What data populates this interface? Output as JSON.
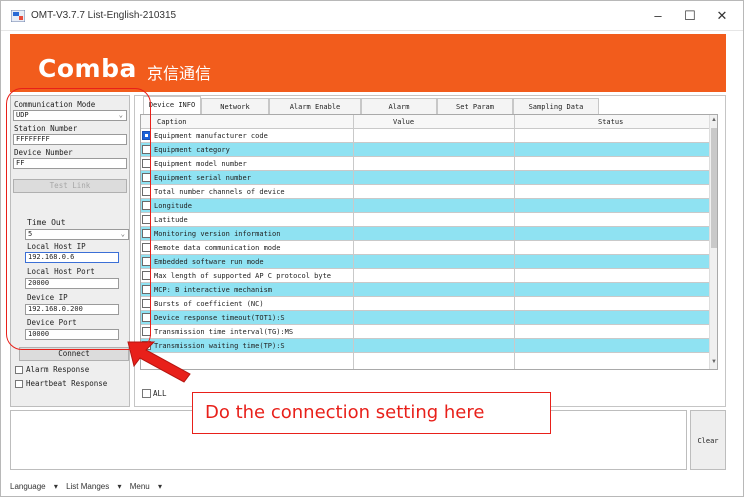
{
  "window": {
    "title": "OMT-V3.7.7  List-English-210315",
    "controls": [
      "–",
      "☐",
      "✕"
    ]
  },
  "banner": {
    "logo_en": "Comba",
    "logo_cn": "京信通信",
    "color": "#f25c1c"
  },
  "left": {
    "comm_mode_label": "Communication Mode",
    "comm_mode_value": "UDP",
    "station_number_label": "Station Number",
    "station_number_value": "FFFFFFFF",
    "device_number_label": "Device Number",
    "device_number_value": "FF",
    "test_link_label": "Test Link",
    "time_out_label": "Time Out",
    "time_out_value": "5",
    "local_host_ip_label": "Local Host IP",
    "local_host_ip_value": "192.168.0.6",
    "local_host_port_label": "Local Host Port",
    "local_host_port_value": "20000",
    "device_ip_label": "Device IP",
    "device_ip_value": "192.168.0.200",
    "device_port_label": "Device Port",
    "device_port_value": "10000",
    "connect_label": "Connect",
    "alarm_response_label": "Alarm Response",
    "heartbeat_response_label": "Heartbeat Response"
  },
  "tabs": [
    "Device INFO",
    "Network",
    "Alarm Enable",
    "Alarm",
    "Set Param",
    "Sampling Data"
  ],
  "grid": {
    "headers": {
      "caption": "Caption",
      "value": "Value",
      "status": "Status"
    },
    "rows": [
      "Equipment manufacturer code",
      "Equipment category",
      "Equipment model number",
      "Equipment serial number",
      "Total number channels of  device",
      "Longitude",
      "Latitude",
      "Monitoring version information",
      "Remote data communication mode",
      "Embedded software run mode",
      "Max length of supported AP C protocol byte",
      "MCP: B interactive mechanism",
      "Bursts of coefficient (NC)",
      "Device response timeout(TOT1):S",
      "Transmission time interval(TG):MS",
      "Transmission waiting time(TP):S"
    ],
    "cyan_color": "#8fe2f2"
  },
  "all_label": "ALL",
  "clear_label": "Clear",
  "callout": "Do the connection setting here",
  "statusbar": {
    "language": "Language",
    "list_manges": "List Manges",
    "menu": "Menu"
  }
}
